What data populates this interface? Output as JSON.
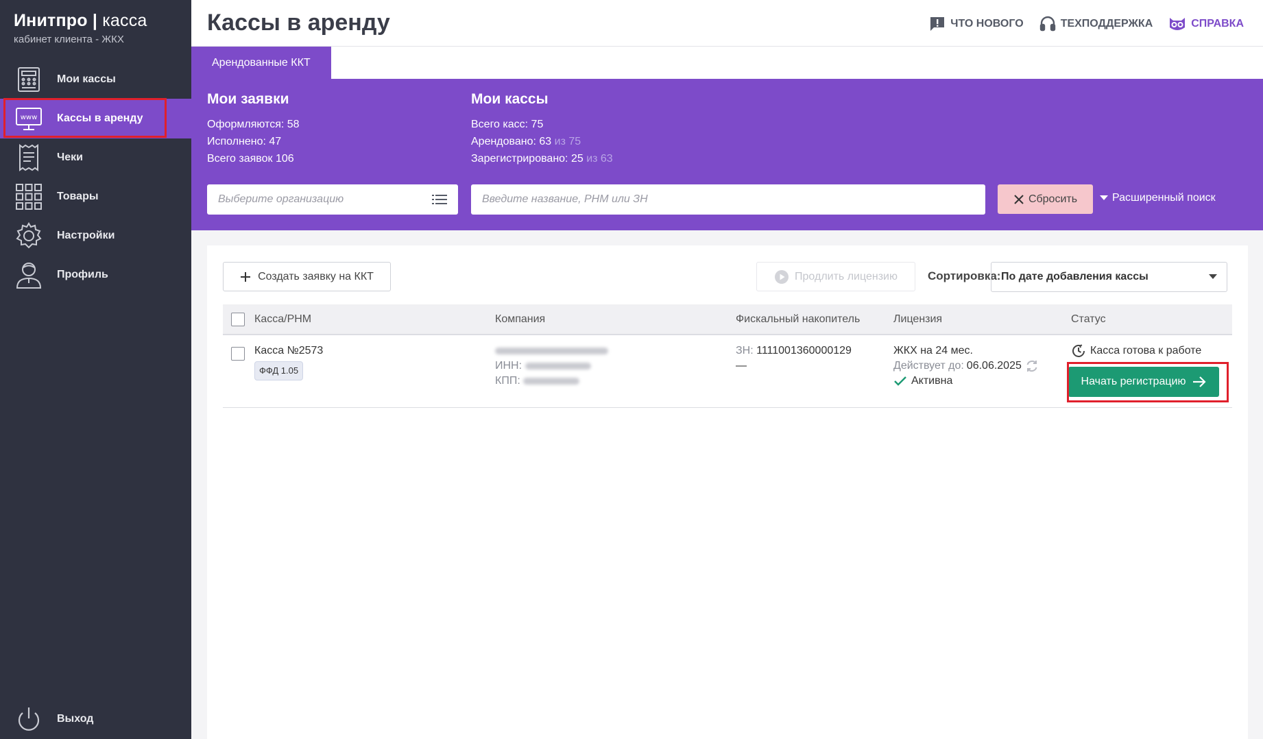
{
  "brand": {
    "title_bold": "Инитпро",
    "title_light": "касса",
    "subtitle": "кабинет клиента - ЖКХ"
  },
  "sidebar": {
    "items": [
      {
        "label": "Мои кассы",
        "icon": "cash-register-icon"
      },
      {
        "label": "Кассы в аренду",
        "icon": "www-monitor-icon",
        "active": true
      },
      {
        "label": "Чеки",
        "icon": "receipt-icon"
      },
      {
        "label": "Товары",
        "icon": "grid-icon"
      },
      {
        "label": "Настройки",
        "icon": "gear-icon"
      },
      {
        "label": "Профиль",
        "icon": "user-icon"
      }
    ],
    "logout": {
      "label": "Выход",
      "icon": "power-icon"
    }
  },
  "header": {
    "title": "Кассы в аренду",
    "links": [
      {
        "label": "ЧТО НОВОГО",
        "icon": "alert-message-icon"
      },
      {
        "label": "ТЕХПОДДЕРЖКА",
        "icon": "headset-icon"
      },
      {
        "label": "СПРАВКА",
        "icon": "owl-icon"
      }
    ]
  },
  "tabs": [
    {
      "label": "Арендованные ККТ",
      "active": true
    }
  ],
  "stats": {
    "requests": {
      "title": "Мои заявки",
      "lines": [
        "Оформляются: 58",
        "Исполнено: 47",
        "Всего заявок 106"
      ]
    },
    "registers": {
      "title": "Мои кассы",
      "total": "Всего касс: 75",
      "rented": "Арендовано: 63",
      "rented_of": "из 75",
      "registered": "Зарегистрировано: 25",
      "registered_of": "из 63"
    }
  },
  "filters": {
    "org_placeholder": "Выберите организацию",
    "search_placeholder": "Введите название, РНМ или ЗН",
    "reset_label": "Сбросить",
    "advanced_label": "Расширенный поиск"
  },
  "toolbar": {
    "create_label": "Создать заявку на ККТ",
    "extend_label": "Продлить лицензию",
    "sort_label": "Сортировка:",
    "sort_value": "По дате добавления кассы"
  },
  "table": {
    "columns": [
      "Касса/РНМ",
      "Компания",
      "Фискальный накопитель",
      "Лицензия",
      "Статус"
    ],
    "rows": [
      {
        "name": "Касса №2573",
        "ffd": "ФФД 1.05",
        "inn_label": "ИНН:",
        "kpp_label": "КПП:",
        "fn_label": "ЗН:",
        "fn_value": "1111001360000129",
        "fn_dash": "—",
        "license": "ЖКХ на 24 мес.",
        "valid_label": "Действует до:",
        "valid_date": "06.06.2025",
        "license_status": "Активна",
        "status": "Касса готова к работе",
        "action_label": "Начать регистрацию"
      }
    ]
  },
  "colors": {
    "sidebar": "#2f3240",
    "accent": "#7d4bc9",
    "success": "#1c9a73",
    "highlight": "#e0202c"
  }
}
